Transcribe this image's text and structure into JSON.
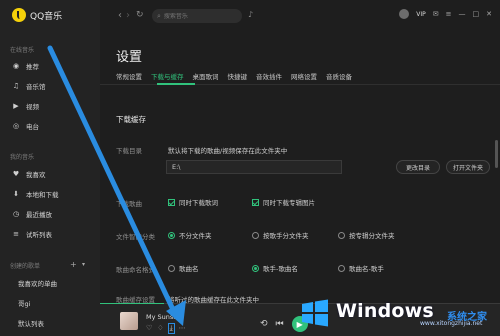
{
  "app": {
    "title": "QQ音乐"
  },
  "sidebar": {
    "section_online": "在线音乐",
    "section_mine": "我的音乐",
    "section_playlists": "创建的歌单",
    "items": [
      {
        "label": "推荐",
        "icon": "disc-icon"
      },
      {
        "label": "音乐馆",
        "icon": "music-hall-icon"
      },
      {
        "label": "视频",
        "icon": "video-icon"
      },
      {
        "label": "电台",
        "icon": "radio-icon"
      },
      {
        "label": "我喜欢",
        "icon": "heart-icon"
      },
      {
        "label": "本地和下载",
        "icon": "download-icon"
      },
      {
        "label": "最近播放",
        "icon": "clock-icon"
      },
      {
        "label": "试听列表",
        "icon": "list-icon"
      },
      {
        "label": "我喜欢的单曲",
        "icon": ""
      },
      {
        "label": "哥gi",
        "icon": ""
      },
      {
        "label": "默认列表",
        "icon": ""
      }
    ]
  },
  "topbar": {
    "search_placeholder": "搜索音乐",
    "vip": "VIP"
  },
  "settings": {
    "title": "设置",
    "tabs": [
      "常规设置",
      "下载与缓存",
      "桌面歌词",
      "快捷键",
      "音效插件",
      "网络设置",
      "音质设备"
    ],
    "active_tab": "下载与缓存",
    "section_title": "下载缓存",
    "download_dir": {
      "label": "下载目录",
      "desc": "默认将下载的歌曲/视频保存在此文件夹中",
      "path": "E:\\",
      "change_btn": "更改目录",
      "open_btn": "打开文件夹"
    },
    "download_lyrics": {
      "label": "下载歌曲",
      "opt1": "同时下载歌词",
      "opt2": "同时下载专辑图片"
    },
    "folder_classify": {
      "label": "文件智能分类",
      "options": [
        "不分文件夹",
        "按歌手分文件夹",
        "按专辑分文件夹"
      ],
      "selected": 0
    },
    "naming": {
      "label": "歌曲命名格式",
      "options": [
        "歌曲名",
        "歌手-歌曲名",
        "歌曲名-歌手"
      ],
      "selected": 1
    },
    "cache": {
      "label": "歌曲缓存设置",
      "desc": "将听过的歌曲缓存在此文件夹中"
    }
  },
  "player": {
    "song": "My Sunshi",
    "progress": 0.16
  },
  "watermark": {
    "text": "Windows",
    "side": "系统之家",
    "url": "www.xitongzhijia.net"
  },
  "colors": {
    "accent": "#31c27c",
    "arrow": "#2a8ce0"
  }
}
